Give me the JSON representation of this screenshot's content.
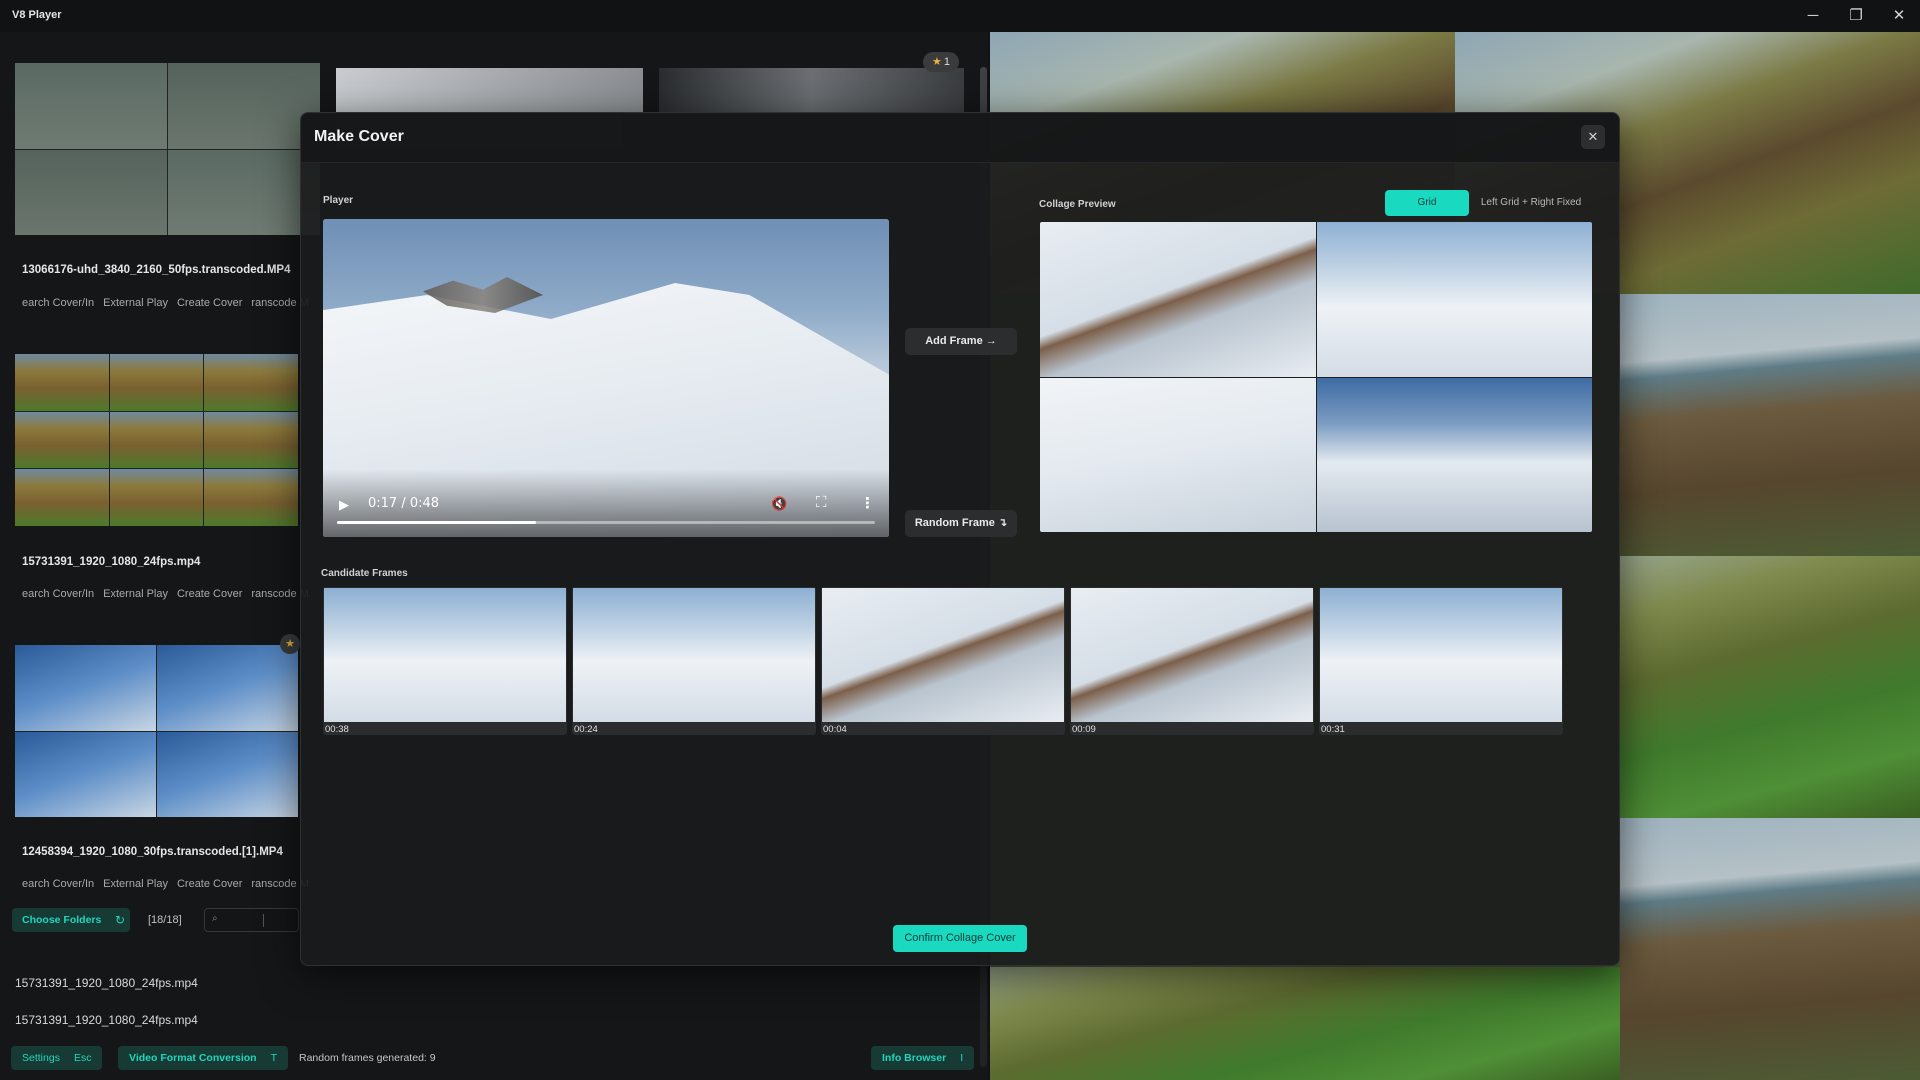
{
  "app": {
    "title": "V8 Player"
  },
  "window_controls": {
    "minimize": "─",
    "maximize": "❐",
    "close": "✕"
  },
  "library": {
    "items": [
      {
        "filename": "13066176-uhd_3840_2160_50fps.transcoded.MP4",
        "actions": [
          "earch Cover/In",
          "External Play",
          "Create Cover",
          "ranscode M"
        ]
      },
      {
        "filename": "15731391_1920_1080_24fps.mp4",
        "actions": [
          "earch Cover/In",
          "External Play",
          "Create Cover",
          "ranscode M"
        ]
      },
      {
        "filename": "12458394_1920_1080_30fps.transcoded.[1].MP4",
        "actions": [
          "earch Cover/In",
          "External Play",
          "Create Cover",
          "ranscode M"
        ]
      }
    ],
    "star_badge": {
      "icon": "★",
      "count": "1"
    },
    "star_dot_icon": "★",
    "choose_folders": "Choose Folders",
    "refresh_icon": "↻",
    "count": "[18/18]",
    "search_icon": "⌕",
    "list_files": [
      "15731391_1920_1080_24fps.mp4",
      "15731391_1920_1080_24fps.mp4"
    ]
  },
  "bottom_bar": {
    "settings": {
      "label": "Settings",
      "key": "Esc"
    },
    "video_format": {
      "label": "Video Format Conversion",
      "key": "T"
    },
    "status": "Random frames generated: 9",
    "info_browser": {
      "label": "Info Browser",
      "key": "I"
    }
  },
  "modal": {
    "title": "Make Cover",
    "close_icon": "✕",
    "player_label": "Player",
    "player": {
      "play_icon": "▶",
      "time": "0:17 / 0:48",
      "progress": 0.37,
      "mute_icon": "🔇",
      "fullscreen_icon": "⛶",
      "more_icon": "⋮"
    },
    "add_frame": "Add Frame →",
    "random_frame": "Random Frame ↴",
    "collage_preview_label": "Collage Preview",
    "layout_options": {
      "grid": "Grid",
      "left_grid_right_fixed": "Left Grid + Right Fixed"
    },
    "candidate_frames_label": "Candidate Frames",
    "candidate_frames": [
      {
        "time": "00:38"
      },
      {
        "time": "00:24"
      },
      {
        "time": "00:04"
      },
      {
        "time": "00:09"
      },
      {
        "time": "00:31"
      }
    ],
    "confirm": "Confirm Collage Cover"
  }
}
